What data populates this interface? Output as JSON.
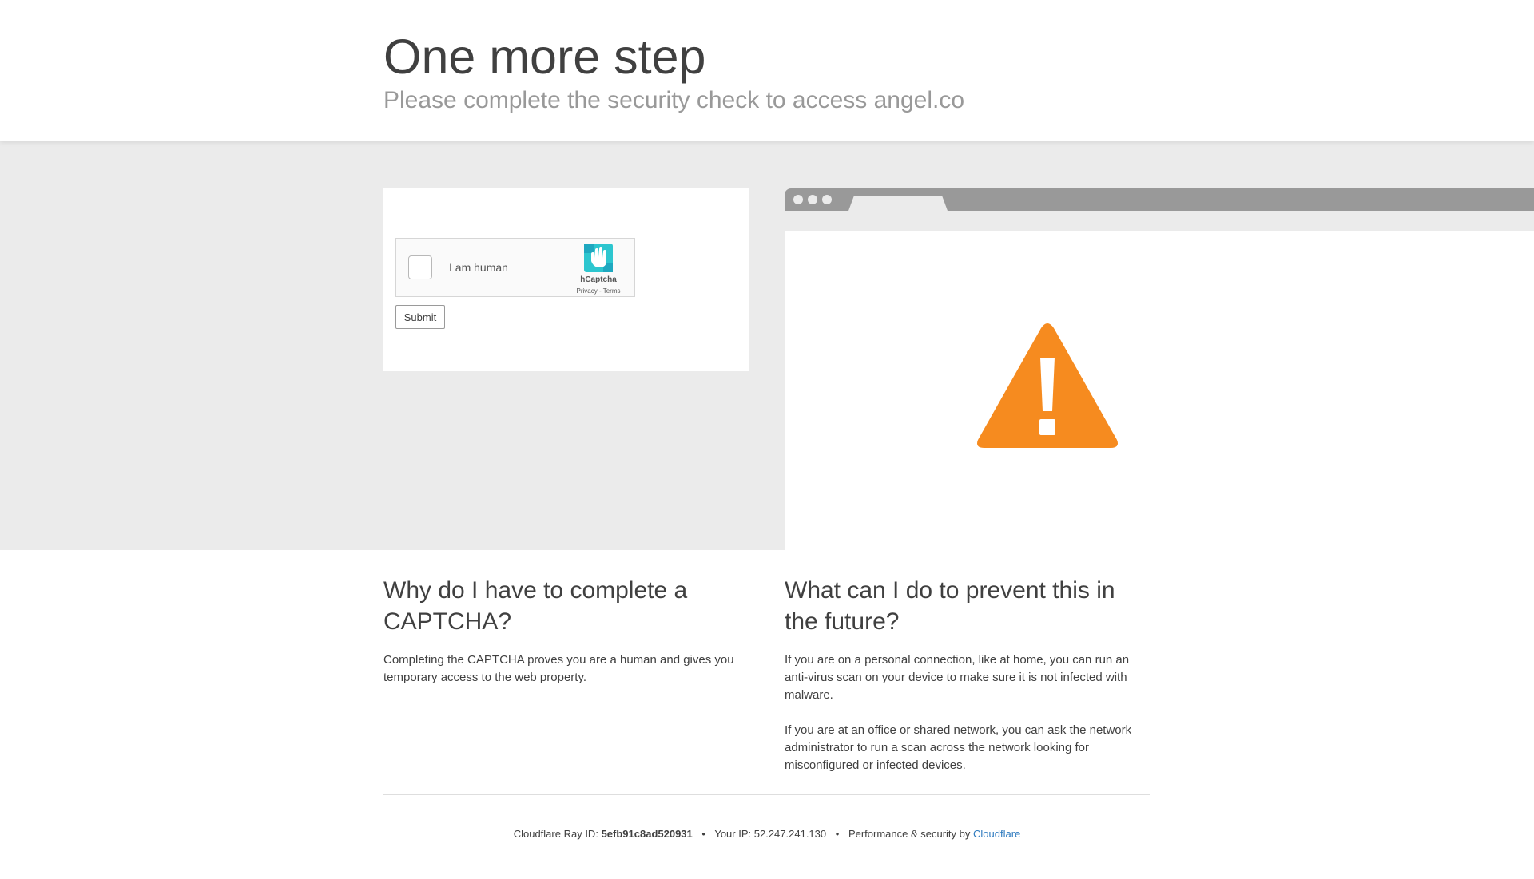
{
  "header": {
    "title": "One more step",
    "subtitle": "Please complete the security check to access angel.co"
  },
  "captcha": {
    "checkbox_label": "I am human",
    "brand": "hCaptcha",
    "privacy_label": "Privacy",
    "link_separator": " - ",
    "terms_label": "Terms",
    "submit_label": "Submit",
    "logo_icon": "hcaptcha-hand-logo"
  },
  "illustration": {
    "icon": "warning-triangle-icon",
    "accent_color": "#f68b1f"
  },
  "faq": {
    "why": {
      "heading": "Why do I have to complete a CAPTCHA?",
      "body": "Completing the CAPTCHA proves you are a human and gives you temporary access to the web property."
    },
    "prevent": {
      "heading": "What can I do to prevent this in the future?",
      "body1": "If you are on a personal connection, like at home, you can run an anti-virus scan on your device to make sure it is not infected with malware.",
      "body2": "If you are at an office or shared network, you can ask the network administrator to run a scan across the network looking for misconfigured or infected devices."
    }
  },
  "footer": {
    "ray_label": "Cloudflare Ray ID:",
    "ray_id": "5efb91c8ad520931",
    "bullet": "•",
    "ip_label": "Your IP:",
    "ip": "52.247.241.130",
    "perf_label": "Performance & security by",
    "cloudflare_link": "Cloudflare",
    "link_color": "#2f7bbf"
  }
}
